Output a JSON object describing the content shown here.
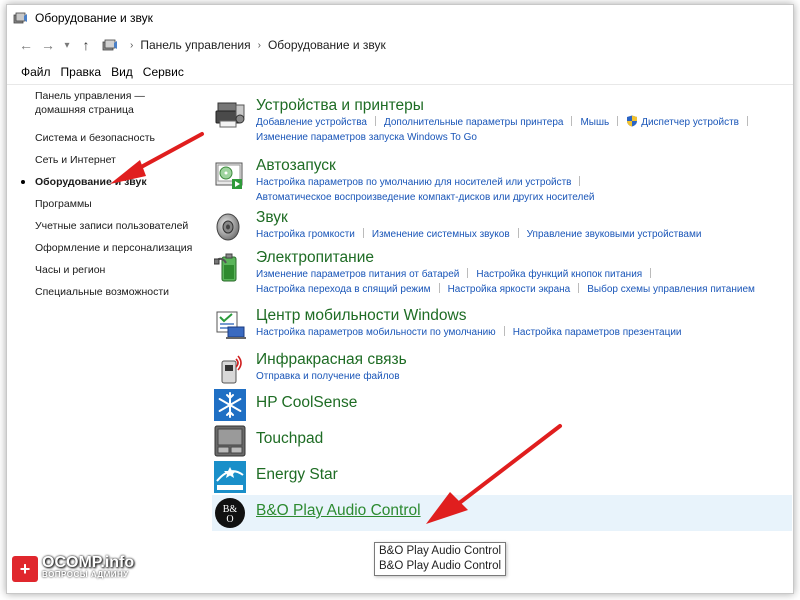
{
  "window": {
    "title": "Оборудование и звук"
  },
  "address": {
    "back": "←",
    "forward": "→",
    "recent": "▾",
    "up": "↑",
    "breadcrumbs": [
      "Панель управления",
      "Оборудование и звук"
    ],
    "sep": "›"
  },
  "menu": [
    "Файл",
    "Правка",
    "Вид",
    "Сервис"
  ],
  "sidebar": {
    "items": [
      "Панель управления — домашняя страница",
      "Система и безопасность",
      "Сеть и Интернет",
      "Оборудование и звук",
      "Программы",
      "Учетные записи пользователей",
      "Оформление и персонализация",
      "Часы и регион",
      "Специальные возможности"
    ],
    "active_index": 3
  },
  "categories": [
    {
      "title": "Устройства и принтеры",
      "icon": "printer-icon",
      "link_rows": [
        [
          "Добавление устройства",
          "Дополнительные параметры принтера",
          "Мышь",
          "Диспетчер устройств"
        ],
        [
          "Изменение параметров запуска Windows To Go"
        ]
      ]
    },
    {
      "title": "Автозапуск",
      "icon": "autoplay-icon",
      "link_rows": [
        [
          "Настройка параметров по умолчанию для носителей или устройств"
        ],
        [
          "Автоматическое воспроизведение компакт-дисков или других носителей"
        ]
      ]
    },
    {
      "title": "Звук",
      "icon": "speaker-icon",
      "link_rows": [
        [
          "Настройка громкости",
          "Изменение системных звуков",
          "Управление звуковыми устройствами"
        ]
      ]
    },
    {
      "title": "Электропитание",
      "icon": "battery-icon",
      "link_rows": [
        [
          "Изменение параметров питания от батарей",
          "Настройка функций кнопок питания"
        ],
        [
          "Настройка перехода в спящий режим",
          "Настройка яркости экрана",
          "Выбор схемы управления питанием"
        ]
      ]
    },
    {
      "title": "Центр мобильности Windows",
      "icon": "mobility-center-icon",
      "link_rows": [
        [
          "Настройка параметров мобильности по умолчанию",
          "Настройка параметров презентации"
        ]
      ]
    },
    {
      "title": "Инфракрасная связь",
      "icon": "infrared-icon",
      "link_rows": [
        [
          "Отправка и получение файлов"
        ]
      ]
    },
    {
      "title": "HP CoolSense",
      "icon": "snowflake-icon",
      "link_rows": []
    },
    {
      "title": "Touchpad",
      "icon": "touchpad-icon",
      "link_rows": []
    },
    {
      "title": "Energy Star",
      "icon": "energy-star-icon",
      "link_rows": []
    },
    {
      "title": "B&O Play Audio Control",
      "icon": "bo-logo-icon",
      "link_rows": []
    }
  ],
  "tooltip": [
    "B&O Play Audio Control",
    "B&O Play Audio Control"
  ],
  "bo_logo": {
    "top": "B&",
    "bottom": "O"
  },
  "watermark": {
    "title": "OCOMP.info",
    "subtitle": "ВОПРОСЫ АДМИНУ",
    "mark": "+"
  },
  "colors": {
    "category_title": "#1e6c24",
    "link": "#1a56b8",
    "hover_background": "#e8f3fb",
    "arrow": "#e01e1e"
  }
}
